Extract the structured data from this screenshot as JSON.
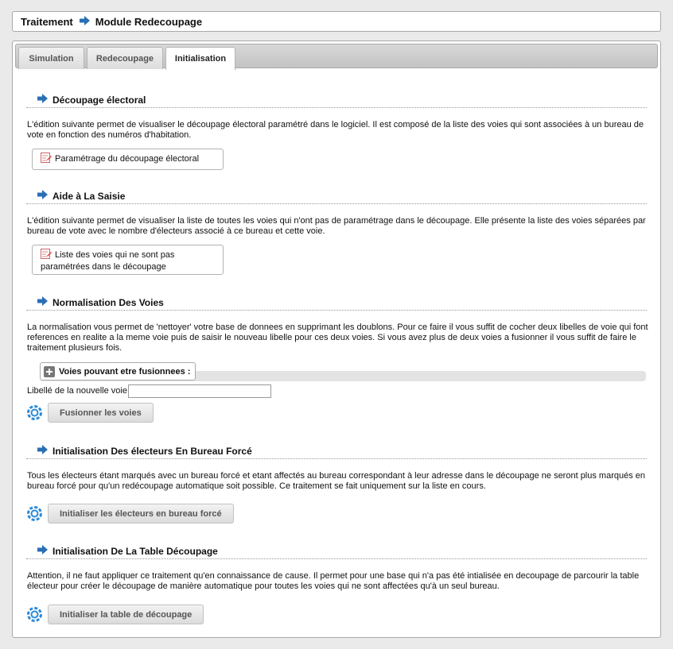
{
  "breadcrumb": {
    "root": "Traitement",
    "current": "Module Redecoupage"
  },
  "tabs": [
    {
      "label": "Simulation"
    },
    {
      "label": "Redecoupage"
    },
    {
      "label": "Initialisation",
      "active": true
    }
  ],
  "sections": {
    "decoupage": {
      "title": "Découpage électoral",
      "description": "L'édition suivante permet de visualiser le découpage électoral paramétré dans le logiciel. Il est composé de la liste des voies qui sont associées à un bureau de vote en fonction des numéros d'habitation.",
      "link_label": "Paramétrage du découpage électoral"
    },
    "aide": {
      "title": "Aide à La Saisie",
      "description": "L'édition suivante permet de visualiser la liste de toutes les voies qui n'ont pas de paramétrage dans le découpage. Elle présente la liste des voies séparées par bureau de vote avec le nombre d'électeurs associé à ce bureau et cette voie.",
      "link_label": "Liste des voies qui ne sont pas paramétrées dans le découpage"
    },
    "normalisation": {
      "title": "Normalisation Des Voies",
      "description": "La normalisation vous permet de 'nettoyer' votre base de donnees en supprimant les doublons. Pour ce faire il vous suffit de cocher deux libelles de voie qui font references en realite a la meme voie puis de saisir le nouveau libelle pour ces deux voies. Si vous avez plus de deux voies a fusionner il vous suffit de faire le traitement plusieurs fois.",
      "fieldset_legend": "Voies pouvant etre fusionnees :",
      "field_label": "Libellé de la nouvelle voie",
      "field_value": "",
      "button_label": "Fusionner les voies"
    },
    "bureau_force": {
      "title": "Initialisation Des électeurs En Bureau Forcé",
      "description": "Tous les électeurs étant marqués avec un bureau forcé et etant affectés au bureau correspondant à leur adresse dans le découpage ne seront plus marqués en bureau forcé pour qu'un redécoupage automatique soit possible. Ce traitement se fait uniquement sur la liste en cours.",
      "button_label": "Initialiser les électeurs en bureau forcé"
    },
    "table": {
      "title": "Initialisation De La Table Découpage",
      "description": "Attention, il ne faut appliquer ce traitement qu'en connaissance de cause. Il permet pour une base qui n'a pas été intialisée en decoupage de parcourir la table électeur pour créer le découpage de manière automatique pour toutes les voies qui ne sont affectées qu'à un seul bureau.",
      "button_label": "Initialiser la table de découpage"
    }
  },
  "colors": {
    "accent_arrow": "#2a6fb5",
    "tab_bar": "#c9c9c9"
  }
}
